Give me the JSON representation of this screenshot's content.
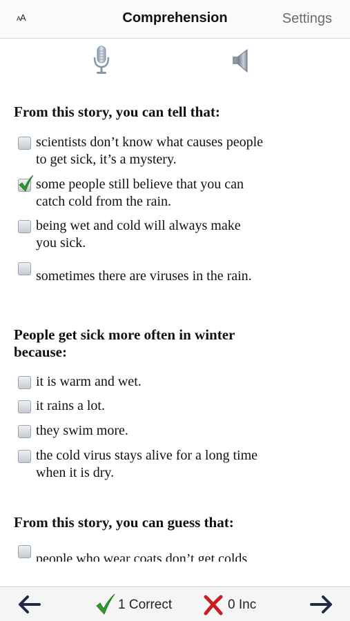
{
  "nav": {
    "font_size_big": "A",
    "font_size_small": "A",
    "title": "Comprehension",
    "settings_label": "Settings"
  },
  "audio": {
    "mic_icon": "microphone-icon",
    "speaker_icon": "speaker-icon"
  },
  "questions": [
    {
      "prompt": "From this story, you can tell that:",
      "options": [
        {
          "line1": "scientists don’t know what causes people",
          "line2": "to get sick, it’s a mystery.",
          "checked": false
        },
        {
          "line1": "some people still believe that you can",
          "line2": "catch cold from the rain.",
          "checked": true
        },
        {
          "line1": "being wet and cold will always make",
          "line2": "you sick.",
          "checked": false
        },
        {
          "line1": "",
          "line2": "sometimes there are viruses in the rain.",
          "checked": false
        }
      ]
    },
    {
      "prompt_line1": "People get sick more often in winter",
      "prompt_line2": "because:",
      "options": [
        {
          "line1": "it is warm and wet.",
          "checked": false
        },
        {
          "line1": "it rains a lot.",
          "checked": false
        },
        {
          "line1": "they swim more.",
          "checked": false
        },
        {
          "line1": "the cold virus stays alive for a long time",
          "line2": "when it is dry.",
          "checked": false
        }
      ]
    },
    {
      "prompt": "From this story, you can guess that:",
      "options": [
        {
          "line1": "people who wear coats don’t get colds",
          "checked": false
        }
      ]
    }
  ],
  "toolbar": {
    "correct_label": "1 Correct",
    "incorrect_label": "0 Inc",
    "correct_color": "#2e9a2e",
    "incorrect_color": "#c81e1e",
    "arrow_color": "#1f2a44"
  }
}
